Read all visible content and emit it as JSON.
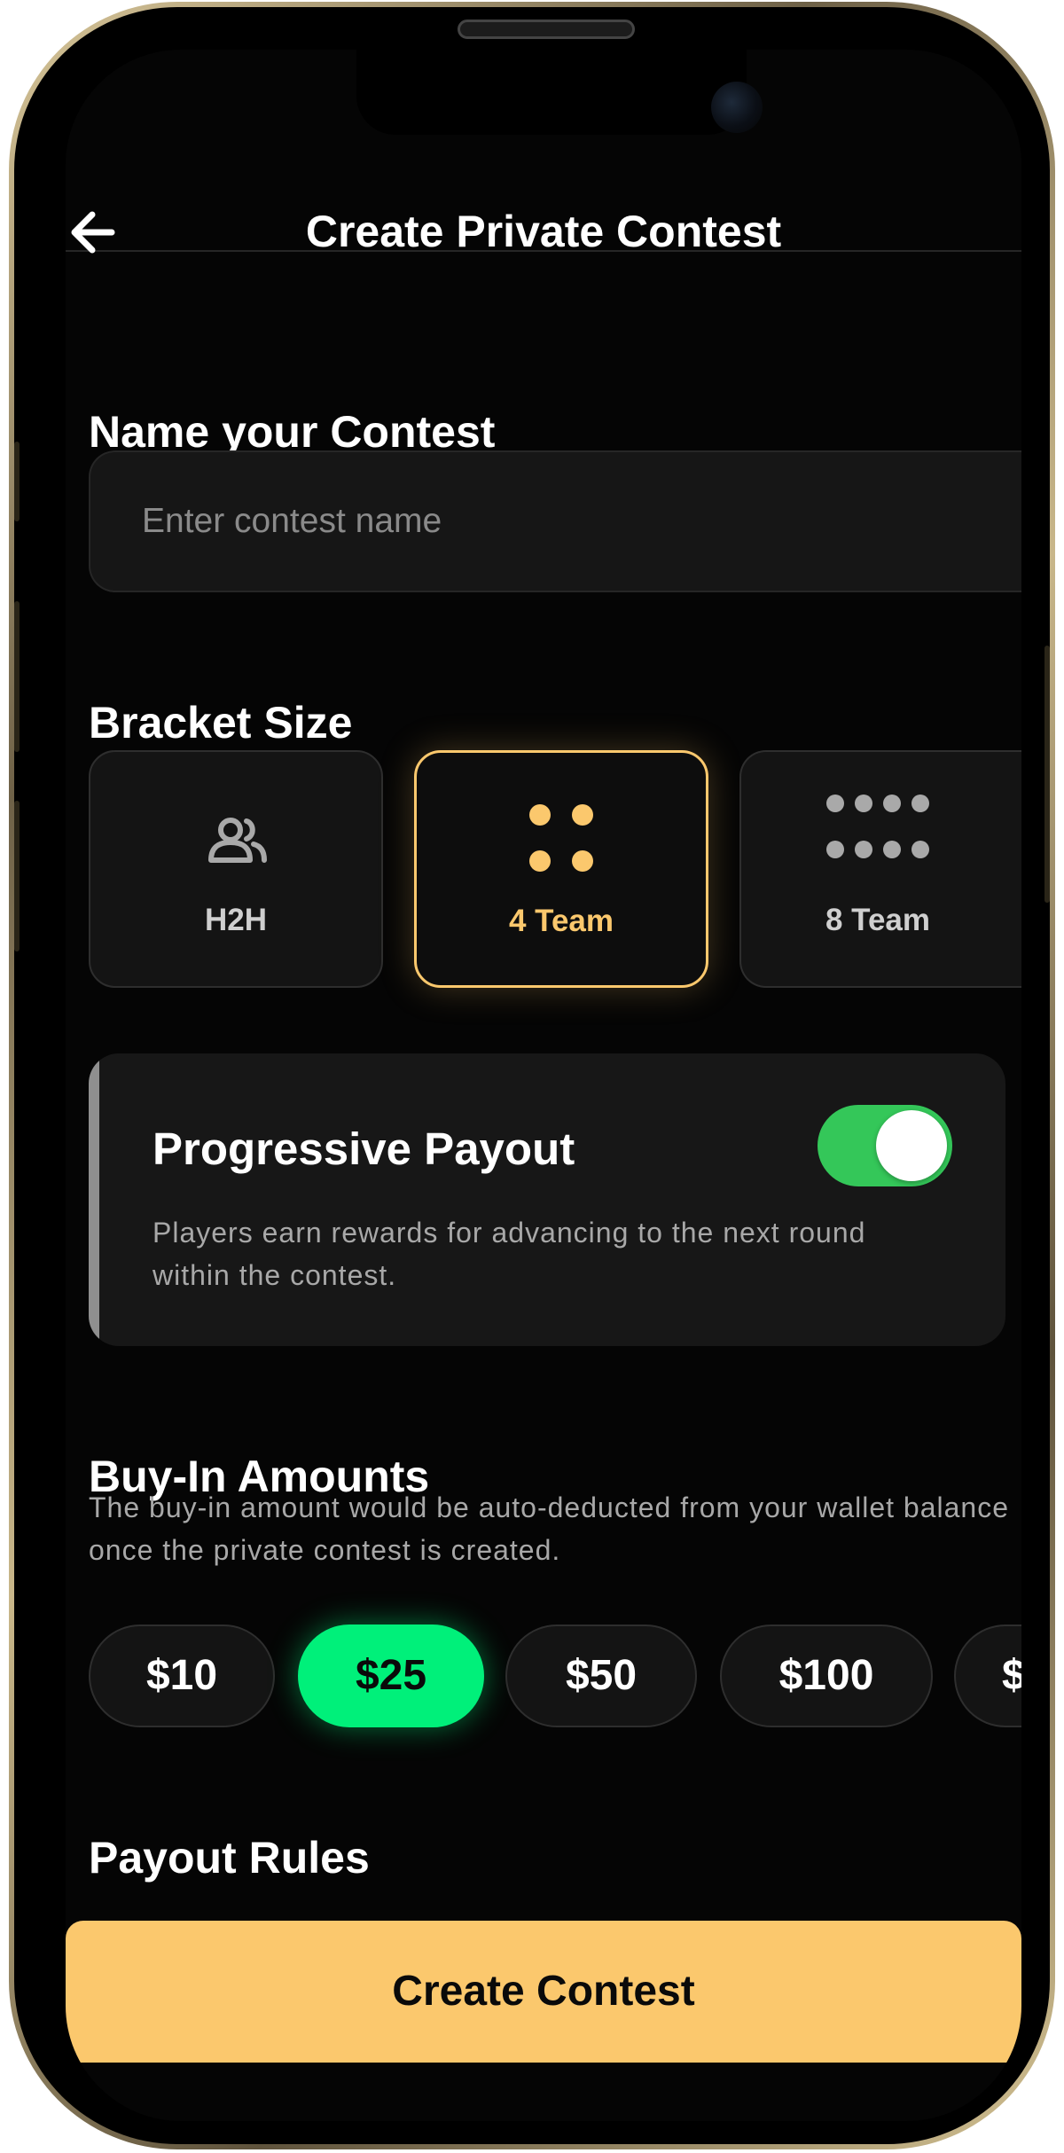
{
  "header": {
    "title": "Create Private Contest",
    "back_icon": "arrow-left-icon"
  },
  "name_section": {
    "title": "Name your Contest",
    "placeholder": "Enter contest name",
    "value": ""
  },
  "bracket_section": {
    "title": "Bracket Size",
    "options": [
      {
        "label": "H2H",
        "icon": "users-icon",
        "selected": false
      },
      {
        "label": "4 Team",
        "icon": "four-dots-icon",
        "selected": true
      },
      {
        "label": "8 Team",
        "icon": "eight-dots-icon",
        "selected": false
      }
    ]
  },
  "progressive_payout": {
    "title": "Progressive Payout",
    "description": "Players earn rewards for advancing to the next round within the contest.",
    "enabled": true
  },
  "buyin_section": {
    "title": "Buy-In Amounts",
    "description": "The buy-in amount would be auto-deducted from your wallet balance once the private contest is created.",
    "amounts": [
      "$10",
      "$25",
      "$50",
      "$100",
      "$"
    ],
    "selected": "$25"
  },
  "payout_rules": {
    "title": "Payout Rules"
  },
  "footer": {
    "create_label": "Create Contest"
  },
  "colors": {
    "accent_gold": "#fbc86d",
    "accent_green": "#00f07a",
    "toggle_green": "#34c759",
    "background": "#050505"
  }
}
